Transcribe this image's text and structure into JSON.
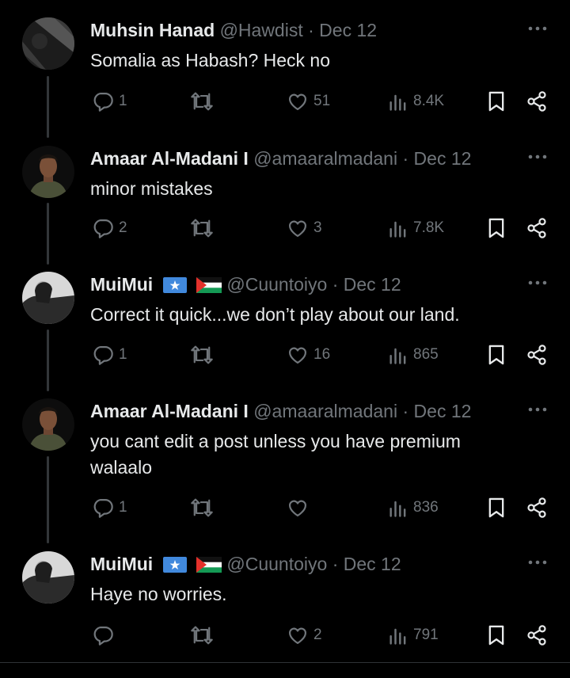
{
  "colors": {
    "background": "#000000",
    "text": "#e7e9ea",
    "muted": "#71767b",
    "thread_line": "#333639"
  },
  "tweets": [
    {
      "name": "Muhsin Hanad",
      "handle": "@Hawdist",
      "sep": "·",
      "date": "Dec 12",
      "text": "Somalia as Habash? Heck no",
      "flags": [],
      "replies": "1",
      "reposts": "",
      "likes": "51",
      "views": "8.4K"
    },
    {
      "name": "Amaar Al-Madani I",
      "handle": "@amaaralmadani",
      "sep": "·",
      "date": "Dec 12",
      "text": "minor mistakes",
      "flags": [],
      "replies": "2",
      "reposts": "",
      "likes": "3",
      "views": "7.8K"
    },
    {
      "name": "MuiMui",
      "handle": "@Cuuntoiyo",
      "sep": "·",
      "date": "Dec 12",
      "text": "Correct it quick...we don’t play about our land.",
      "flags": [
        "somalia-flag-icon",
        "palestine-flag-icon"
      ],
      "replies": "1",
      "reposts": "",
      "likes": "16",
      "views": "865"
    },
    {
      "name": "Amaar Al-Madani I",
      "handle": "@amaaralmadani",
      "sep": "·",
      "date": "Dec 12",
      "text": "you cant edit a post unless you have premium walaalo",
      "flags": [],
      "replies": "1",
      "reposts": "",
      "likes": "",
      "views": "836"
    },
    {
      "name": "MuiMui",
      "handle": "@Cuuntoiyo",
      "sep": "·",
      "date": "Dec 12",
      "text": "Haye no worries.",
      "flags": [
        "somalia-flag-icon",
        "palestine-flag-icon"
      ],
      "replies": "",
      "reposts": "",
      "likes": "2",
      "views": "791"
    }
  ],
  "icons": [
    "reply-icon",
    "repost-icon",
    "like-icon",
    "views-icon",
    "bookmark-icon",
    "share-icon",
    "more-icon"
  ]
}
